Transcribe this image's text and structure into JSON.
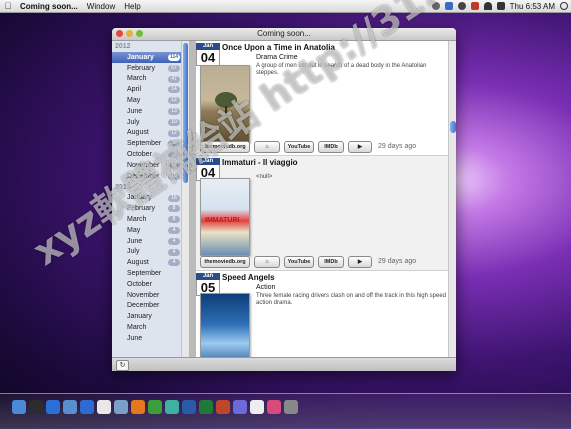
{
  "menubar": {
    "app_name": "Coming soon...",
    "items": [
      "Window",
      "Help"
    ],
    "clock": "Thu 6:53 AM",
    "status_icons": [
      "wifi-icon",
      "volume-icon",
      "bluetooth-icon",
      "time-machine-icon",
      "sync-icon",
      "flag-icon",
      "spotlight-icon"
    ]
  },
  "window": {
    "title": "Coming soon...",
    "colors": {
      "accent": "#3d62b8",
      "selected_row": "#5b7cc6",
      "date_badge": "#2b4c8c"
    }
  },
  "sidebar": {
    "groups": [
      {
        "year": "2012",
        "months": [
          {
            "name": "January",
            "count": "114",
            "selected": true
          },
          {
            "name": "February",
            "count": "67"
          },
          {
            "name": "March",
            "count": "47"
          },
          {
            "name": "April",
            "count": "14"
          },
          {
            "name": "May",
            "count": "12"
          },
          {
            "name": "June",
            "count": "13"
          },
          {
            "name": "July",
            "count": "10"
          },
          {
            "name": "August",
            "count": "12"
          },
          {
            "name": "September",
            "count": "18"
          },
          {
            "name": "October",
            "count": "12"
          },
          {
            "name": "November",
            "count": "12"
          },
          {
            "name": "December",
            "count": "10"
          }
        ]
      },
      {
        "year": "2013",
        "months": [
          {
            "name": "January",
            "count": "16"
          },
          {
            "name": "February",
            "count": "8"
          },
          {
            "name": "March",
            "count": "8"
          },
          {
            "name": "May",
            "count": "4"
          },
          {
            "name": "June",
            "count": "4"
          },
          {
            "name": "July",
            "count": "4"
          },
          {
            "name": "August",
            "count": "4"
          },
          {
            "name": "September",
            "count": ""
          },
          {
            "name": "October",
            "count": ""
          },
          {
            "name": "November",
            "count": ""
          },
          {
            "name": "December",
            "count": ""
          },
          {
            "name": "January",
            "count": ""
          },
          {
            "name": "March",
            "count": ""
          },
          {
            "name": "June",
            "count": ""
          }
        ]
      }
    ]
  },
  "entries": [
    {
      "month": "Jan",
      "day": "04",
      "title": "Once Upon a Time in Anatolia",
      "genres": "Drama  Crime",
      "plot": "A group of men set out in search of a dead body in the Anatolian steppes.",
      "buttons": {
        "tmdb": "themoviedb.org",
        "youtube": "YouTube",
        "imdb": "IMDb"
      },
      "ago": "29 days ago"
    },
    {
      "month": "Jan",
      "day": "04",
      "title": "Immaturi - Il viaggio",
      "genres": "",
      "plot": "<null>",
      "buttons": {
        "tmdb": "themoviedb.org",
        "youtube": "YouTube",
        "imdb": "IMDb"
      },
      "ago": "29 days ago"
    },
    {
      "month": "Jan",
      "day": "05",
      "title": "Speed Angels",
      "genres": "Action",
      "plot": "Three female racing drivers clash on and off the track in this high speed action drama.",
      "buttons": {
        "tmdb": "",
        "youtube": "",
        "imdb": ""
      },
      "ago": ""
    }
  ],
  "watermark": "xyz軟體補給站 http://31.to",
  "dock": {
    "icons": [
      "finder-icon",
      "dashboard-icon",
      "safari-icon",
      "mail-icon",
      "itunes-icon",
      "calendar-icon",
      "photo-icon",
      "firefox-icon",
      "evernote-icon",
      "app-icon",
      "word-icon",
      "excel-icon",
      "powerpoint-icon",
      "app-icon-2",
      "wifi-icon",
      "app-icon-3",
      "trash-icon"
    ]
  }
}
